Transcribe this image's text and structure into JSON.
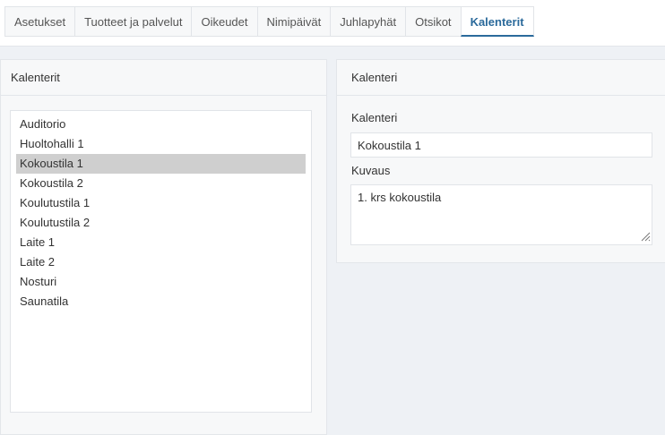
{
  "tabs": [
    {
      "label": "Asetukset",
      "active": false
    },
    {
      "label": "Tuotteet ja palvelut",
      "active": false
    },
    {
      "label": "Oikeudet",
      "active": false
    },
    {
      "label": "Nimipäivät",
      "active": false
    },
    {
      "label": "Juhlapyhät",
      "active": false
    },
    {
      "label": "Otsikot",
      "active": false
    },
    {
      "label": "Kalenterit",
      "active": true
    }
  ],
  "left_panel": {
    "title": "Kalenterit",
    "items": [
      {
        "label": "Auditorio",
        "selected": false
      },
      {
        "label": "Huoltohalli 1",
        "selected": false
      },
      {
        "label": "Kokoustila 1",
        "selected": true
      },
      {
        "label": "Kokoustila 2",
        "selected": false
      },
      {
        "label": "Koulutustila 1",
        "selected": false
      },
      {
        "label": "Koulutustila 2",
        "selected": false
      },
      {
        "label": "Laite 1",
        "selected": false
      },
      {
        "label": "Laite 2",
        "selected": false
      },
      {
        "label": "Nosturi",
        "selected": false
      },
      {
        "label": "Saunatila",
        "selected": false
      }
    ]
  },
  "right_panel": {
    "title": "Kalenteri",
    "name_label": "Kalenteri",
    "name_value": "Kokoustila 1",
    "description_label": "Kuvaus",
    "description_value": "1. krs kokoustila"
  },
  "colors": {
    "accent": "#2b6a9b",
    "selected_bg": "#cfcfcf",
    "panel_bg": "#f7f8f9",
    "page_bg": "#eef1f5"
  },
  "icons": {
    "resize_grip": "resize-grip-icon"
  }
}
